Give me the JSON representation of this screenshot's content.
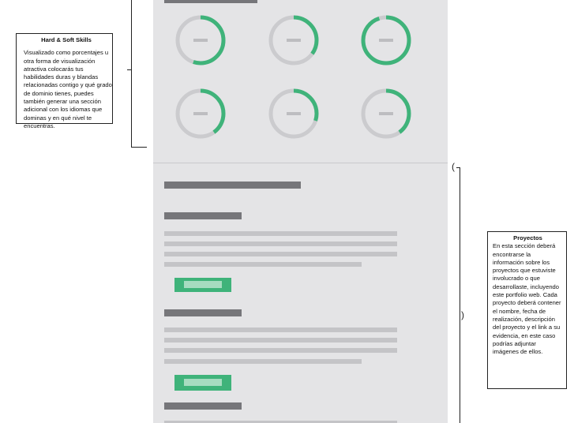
{
  "skills": {
    "ring_levels": [
      0.55,
      0.35,
      0.95,
      0.4,
      0.3,
      0.4
    ],
    "colors": {
      "track": "#cbcbce",
      "fill": "#3fb37a",
      "dash": "#bdbdc0"
    }
  },
  "projects": {
    "items": [
      {
        "lines": 4,
        "has_link_button": true
      },
      {
        "lines": 4,
        "has_link_button": true
      }
    ]
  },
  "notes": {
    "skills": {
      "title": "Hard & Soft Skills",
      "body": "Visualizado como porcentajes u otra forma de visualización atractiva colocarás tus habilidades duras y blandas relacionadas contigo y qué grado de dominio tienes, puedes también generar una sección adicional con los idiomas que dominas y en qué nivel te encuentras."
    },
    "projects": {
      "title": "Proyectos",
      "body": "En esta sección deberá encontrarse la información sobre los proyectos que estuviste involucrado o que desarrollaste, incluyendo este portfolio web. Cada proyecto deberá contener el nombre, fecha de realización, descripción del proyecto y el link a su evidencia, en este caso podrías adjuntar imágenes de ellos."
    }
  }
}
